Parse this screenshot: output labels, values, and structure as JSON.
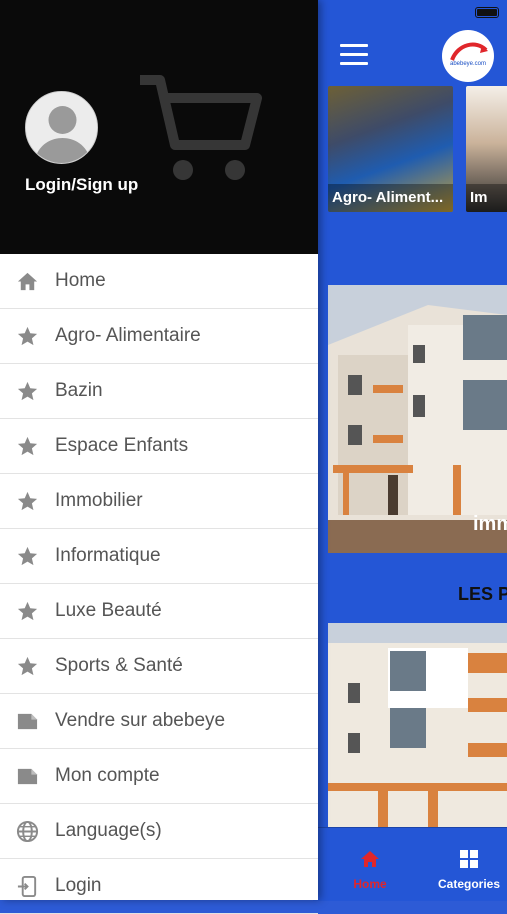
{
  "app": {
    "logo_text": "abebeye.com",
    "categories": [
      {
        "label": "Agro- Aliment..."
      },
      {
        "label": "Im"
      }
    ],
    "banner_label": "imm",
    "section_title": "LES P"
  },
  "tabbar": {
    "home_label": "Home",
    "categories_label": "Categories"
  },
  "drawer": {
    "login_title": "Login/Sign up",
    "menu": [
      {
        "label": "Home",
        "icon": "home-icon"
      },
      {
        "label": "Agro- Alimentaire",
        "icon": "star-icon"
      },
      {
        "label": "Bazin",
        "icon": "star-icon"
      },
      {
        "label": "Espace Enfants",
        "icon": "star-icon"
      },
      {
        "label": "Immobilier",
        "icon": "star-icon"
      },
      {
        "label": "Informatique",
        "icon": "star-icon"
      },
      {
        "label": "Luxe Beauté",
        "icon": "star-icon"
      },
      {
        "label": "Sports & Santé",
        "icon": "star-icon"
      },
      {
        "label": "Vendre sur abebeye",
        "icon": "folder-icon"
      },
      {
        "label": "Mon compte",
        "icon": "folder-icon"
      },
      {
        "label": "Language(s)",
        "icon": "globe-icon"
      },
      {
        "label": "Login",
        "icon": "login-icon"
      }
    ]
  },
  "colors": {
    "primary_blue": "#2456d6",
    "active_red": "#e0262b",
    "drawer_header": "#0a0a0a",
    "icon_gray": "#8a8a8a"
  }
}
